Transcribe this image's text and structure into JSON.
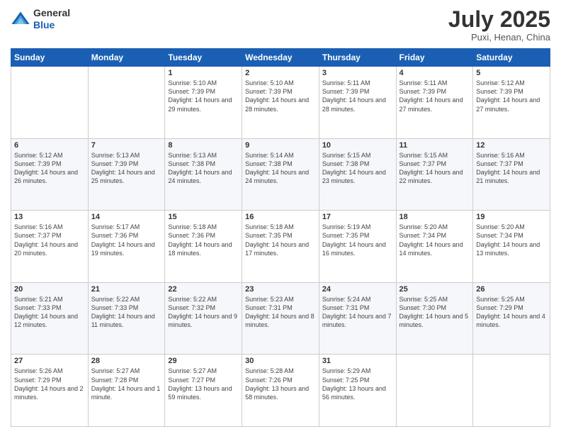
{
  "header": {
    "logo_general": "General",
    "logo_blue": "Blue",
    "month": "July 2025",
    "location": "Puxi, Henan, China"
  },
  "weekdays": [
    "Sunday",
    "Monday",
    "Tuesday",
    "Wednesday",
    "Thursday",
    "Friday",
    "Saturday"
  ],
  "weeks": [
    [
      {
        "day": "",
        "content": ""
      },
      {
        "day": "",
        "content": ""
      },
      {
        "day": "1",
        "content": "Sunrise: 5:10 AM\nSunset: 7:39 PM\nDaylight: 14 hours and 29 minutes."
      },
      {
        "day": "2",
        "content": "Sunrise: 5:10 AM\nSunset: 7:39 PM\nDaylight: 14 hours and 28 minutes."
      },
      {
        "day": "3",
        "content": "Sunrise: 5:11 AM\nSunset: 7:39 PM\nDaylight: 14 hours and 28 minutes."
      },
      {
        "day": "4",
        "content": "Sunrise: 5:11 AM\nSunset: 7:39 PM\nDaylight: 14 hours and 27 minutes."
      },
      {
        "day": "5",
        "content": "Sunrise: 5:12 AM\nSunset: 7:39 PM\nDaylight: 14 hours and 27 minutes."
      }
    ],
    [
      {
        "day": "6",
        "content": "Sunrise: 5:12 AM\nSunset: 7:39 PM\nDaylight: 14 hours and 26 minutes."
      },
      {
        "day": "7",
        "content": "Sunrise: 5:13 AM\nSunset: 7:39 PM\nDaylight: 14 hours and 25 minutes."
      },
      {
        "day": "8",
        "content": "Sunrise: 5:13 AM\nSunset: 7:38 PM\nDaylight: 14 hours and 24 minutes."
      },
      {
        "day": "9",
        "content": "Sunrise: 5:14 AM\nSunset: 7:38 PM\nDaylight: 14 hours and 24 minutes."
      },
      {
        "day": "10",
        "content": "Sunrise: 5:15 AM\nSunset: 7:38 PM\nDaylight: 14 hours and 23 minutes."
      },
      {
        "day": "11",
        "content": "Sunrise: 5:15 AM\nSunset: 7:37 PM\nDaylight: 14 hours and 22 minutes."
      },
      {
        "day": "12",
        "content": "Sunrise: 5:16 AM\nSunset: 7:37 PM\nDaylight: 14 hours and 21 minutes."
      }
    ],
    [
      {
        "day": "13",
        "content": "Sunrise: 5:16 AM\nSunset: 7:37 PM\nDaylight: 14 hours and 20 minutes."
      },
      {
        "day": "14",
        "content": "Sunrise: 5:17 AM\nSunset: 7:36 PM\nDaylight: 14 hours and 19 minutes."
      },
      {
        "day": "15",
        "content": "Sunrise: 5:18 AM\nSunset: 7:36 PM\nDaylight: 14 hours and 18 minutes."
      },
      {
        "day": "16",
        "content": "Sunrise: 5:18 AM\nSunset: 7:35 PM\nDaylight: 14 hours and 17 minutes."
      },
      {
        "day": "17",
        "content": "Sunrise: 5:19 AM\nSunset: 7:35 PM\nDaylight: 14 hours and 16 minutes."
      },
      {
        "day": "18",
        "content": "Sunrise: 5:20 AM\nSunset: 7:34 PM\nDaylight: 14 hours and 14 minutes."
      },
      {
        "day": "19",
        "content": "Sunrise: 5:20 AM\nSunset: 7:34 PM\nDaylight: 14 hours and 13 minutes."
      }
    ],
    [
      {
        "day": "20",
        "content": "Sunrise: 5:21 AM\nSunset: 7:33 PM\nDaylight: 14 hours and 12 minutes."
      },
      {
        "day": "21",
        "content": "Sunrise: 5:22 AM\nSunset: 7:33 PM\nDaylight: 14 hours and 11 minutes."
      },
      {
        "day": "22",
        "content": "Sunrise: 5:22 AM\nSunset: 7:32 PM\nDaylight: 14 hours and 9 minutes."
      },
      {
        "day": "23",
        "content": "Sunrise: 5:23 AM\nSunset: 7:31 PM\nDaylight: 14 hours and 8 minutes."
      },
      {
        "day": "24",
        "content": "Sunrise: 5:24 AM\nSunset: 7:31 PM\nDaylight: 14 hours and 7 minutes."
      },
      {
        "day": "25",
        "content": "Sunrise: 5:25 AM\nSunset: 7:30 PM\nDaylight: 14 hours and 5 minutes."
      },
      {
        "day": "26",
        "content": "Sunrise: 5:25 AM\nSunset: 7:29 PM\nDaylight: 14 hours and 4 minutes."
      }
    ],
    [
      {
        "day": "27",
        "content": "Sunrise: 5:26 AM\nSunset: 7:29 PM\nDaylight: 14 hours and 2 minutes."
      },
      {
        "day": "28",
        "content": "Sunrise: 5:27 AM\nSunset: 7:28 PM\nDaylight: 14 hours and 1 minute."
      },
      {
        "day": "29",
        "content": "Sunrise: 5:27 AM\nSunset: 7:27 PM\nDaylight: 13 hours and 59 minutes."
      },
      {
        "day": "30",
        "content": "Sunrise: 5:28 AM\nSunset: 7:26 PM\nDaylight: 13 hours and 58 minutes."
      },
      {
        "day": "31",
        "content": "Sunrise: 5:29 AM\nSunset: 7:25 PM\nDaylight: 13 hours and 56 minutes."
      },
      {
        "day": "",
        "content": ""
      },
      {
        "day": "",
        "content": ""
      }
    ]
  ]
}
